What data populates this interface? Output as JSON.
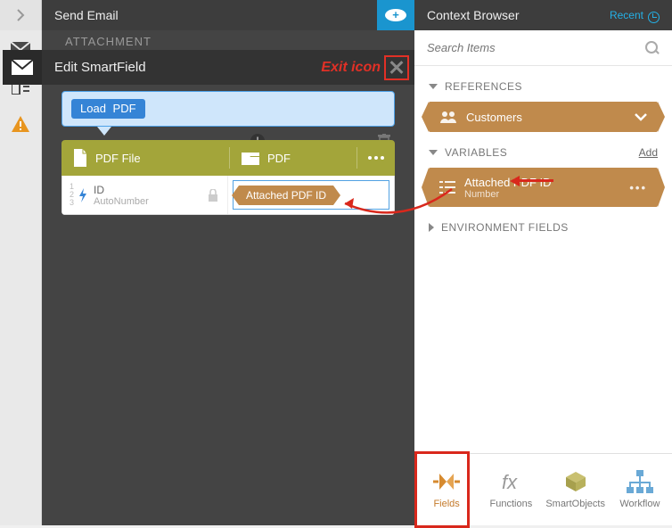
{
  "title": {
    "send_email": "Send Email",
    "context_browser": "Context Browser",
    "recent": "Recent"
  },
  "edit_bar": {
    "label": "Edit SmartField",
    "exit_label": "Exit icon"
  },
  "attachment_label": "ATTACHMENT",
  "load_tag": {
    "action": "Load",
    "object": "PDF"
  },
  "pdf_card": {
    "left": "PDF File",
    "right": "PDF"
  },
  "id_row": {
    "name": "ID",
    "type": "AutoNumber"
  },
  "value_tag": "Attached PDF ID",
  "search": {
    "placeholder": "Search Items"
  },
  "sections": {
    "references": "REFERENCES",
    "variables": "VARIABLES",
    "environment": "ENVIRONMENT FIELDS",
    "add": "Add"
  },
  "ref_item": {
    "label": "Customers"
  },
  "var_item": {
    "label": "Attached PDF ID",
    "type": "Number"
  },
  "tabs": {
    "fields": "Fields",
    "functions": "Functions",
    "smartobjects": "SmartObjects",
    "workflow": "Workflow"
  }
}
